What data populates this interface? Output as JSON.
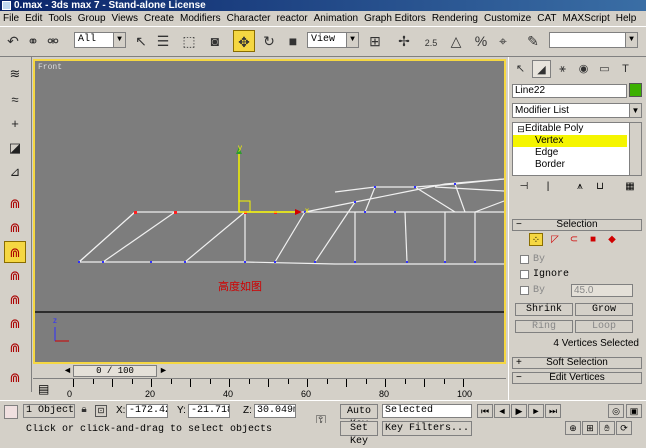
{
  "title": "0.max - 3ds max 7 - Stand-alone License",
  "menu": [
    "File",
    "Edit",
    "Tools",
    "Group",
    "Views",
    "Create",
    "Modifiers",
    "Character",
    "reactor",
    "Animation",
    "Graph Editors",
    "Rendering",
    "Customize",
    "CAT",
    "MAXScript",
    "Help"
  ],
  "toolbar": {
    "selection_filter": "All",
    "ref_coord": "View",
    "snap_angle": "2.5",
    "named_selection": ""
  },
  "viewport": {
    "label": "Front",
    "annotation": "高度如图",
    "axis_labels": {
      "y": "y",
      "x": "x",
      "z": "z"
    }
  },
  "timeline": {
    "slider": "0 / 100",
    "ticks": [
      "0",
      "20",
      "40",
      "60",
      "80",
      "100"
    ]
  },
  "status": {
    "selection_count": "1 Object",
    "x_label": "X:",
    "x_value": "-172.426",
    "y_label": "Y:",
    "y_value": "-21.718",
    "z_label": "Z:",
    "z_value": "30.049mm",
    "auto_key": "Auto Key",
    "set_key": "Set Key",
    "key_mode": "Selected",
    "key_filters": "Key Filters...",
    "prompt": "Click or click-and-drag to select objects"
  },
  "command_panel": {
    "object_name": "Line22",
    "object_color": "#3cb000",
    "modifier_list": "Modifier List",
    "stack": [
      {
        "label": "Editable Poly",
        "level": 0,
        "prefix": "⊟",
        "selected": false
      },
      {
        "label": "Vertex",
        "level": 1,
        "selected": true
      },
      {
        "label": "Edge",
        "level": 1,
        "selected": false
      },
      {
        "label": "Border",
        "level": 1,
        "selected": false
      }
    ],
    "selection_rollout": "Selection",
    "by_label": "By",
    "ignore_label": "Ignore",
    "by_label2": "By",
    "threshold": "45.0",
    "shrink": "Shrink",
    "grow": "Grow",
    "ring": "Ring",
    "loop": "Loop",
    "vertices_selected": "4 Vertices Selected",
    "soft_selection": "Soft Selection",
    "edit_vertices": "Edit Vertices"
  },
  "icons": {
    "accent": "#f5d742",
    "selection_yellow": "#f5f500",
    "annotation_red": "#d00000"
  }
}
